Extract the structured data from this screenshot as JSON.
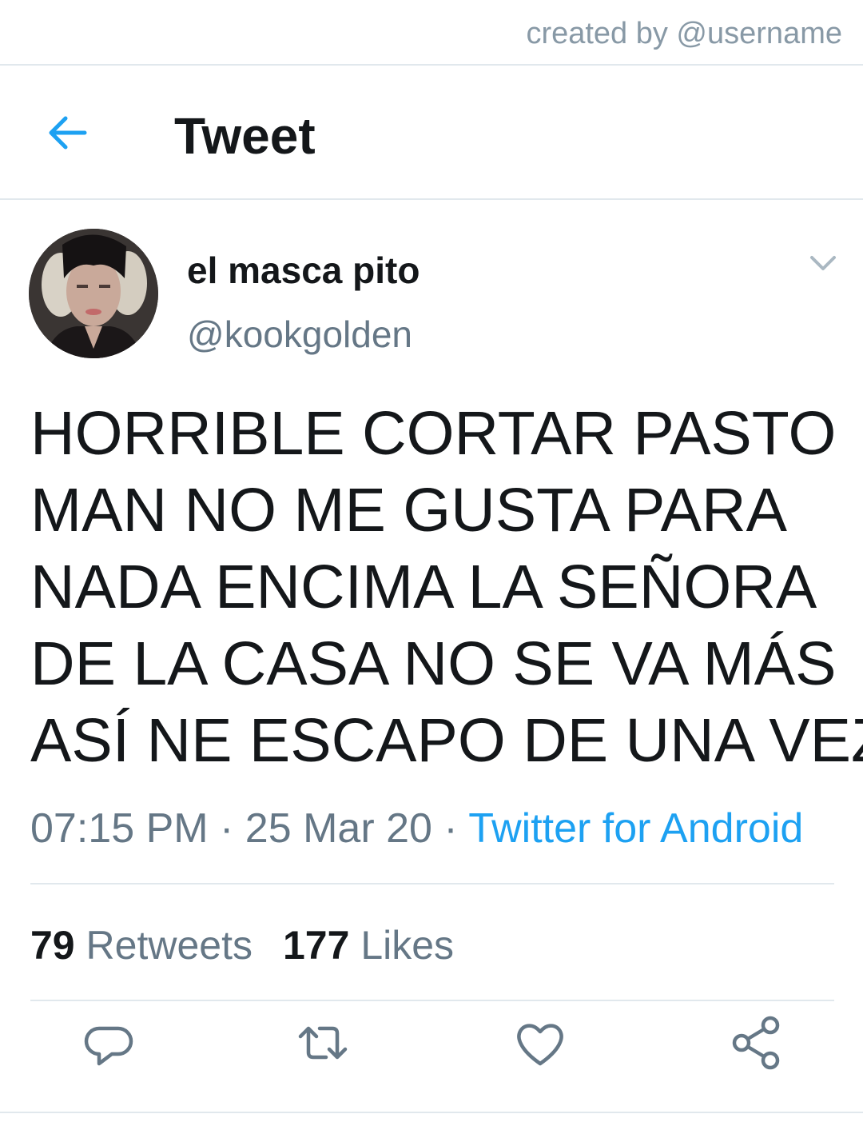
{
  "watermark": "created by @username",
  "header": {
    "title": "Tweet",
    "back_icon": "arrow-left-icon",
    "accent_color": "#1da1f2"
  },
  "tweet": {
    "display_name": "el masca pito",
    "handle": "@kookgolden",
    "text_lines": [
      "HORRIBLE CORTAR PASTO",
      "MAN NO ME GUSTA PARA",
      "NADA ENCIMA LA SEÑORA",
      "DE LA CASA NO SE VA MÁS",
      "ASÍ NE ESCAPO DE UNA VEZ"
    ],
    "time": "07:15 PM",
    "separator": " · ",
    "date": "25 Mar 20",
    "source": "Twitter for Android"
  },
  "stats": {
    "retweets_count": "79",
    "retweets_label": "Retweets",
    "likes_count": "177",
    "likes_label": "Likes"
  },
  "actions": {
    "reply_icon": "reply-icon",
    "retweet_icon": "retweet-icon",
    "like_icon": "heart-icon",
    "share_icon": "share-icon"
  },
  "colors": {
    "text_primary": "#14171a",
    "text_secondary": "#657786",
    "divider": "#e1e8ed",
    "icon": "#657786"
  }
}
